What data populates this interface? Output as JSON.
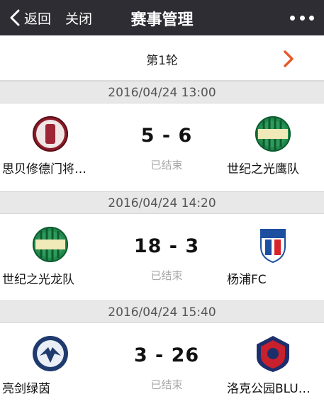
{
  "navbar": {
    "back_label": "返回",
    "close_label": "关闭",
    "title": "赛事管理",
    "more_icon": "more-dots-icon"
  },
  "round": {
    "label": "第1轮",
    "next_icon": "chevron-right-icon",
    "accent": "#e55a2b"
  },
  "matches": [
    {
      "datetime": "2016/04/24 13:00",
      "home": {
        "name": "思贝修德门将…",
        "logo": "red-crest-logo"
      },
      "away": {
        "name": "世纪之光鹰队",
        "logo": "century-light-logo"
      },
      "score": "5 - 6",
      "status": "已结束"
    },
    {
      "datetime": "2016/04/24 14:20",
      "home": {
        "name": "世纪之光龙队",
        "logo": "century-light-logo"
      },
      "away": {
        "name": "杨浦FC",
        "logo": "shenhua-style-logo"
      },
      "score": "18 - 3",
      "status": "已结束"
    },
    {
      "datetime": "2016/04/24 15:40",
      "home": {
        "name": "亮剑绿茵",
        "logo": "blue-eagle-logo"
      },
      "away": {
        "name": "洛克公园BLU…",
        "logo": "rock-park-logo"
      },
      "score": "3 - 26",
      "status": "已结束"
    }
  ]
}
